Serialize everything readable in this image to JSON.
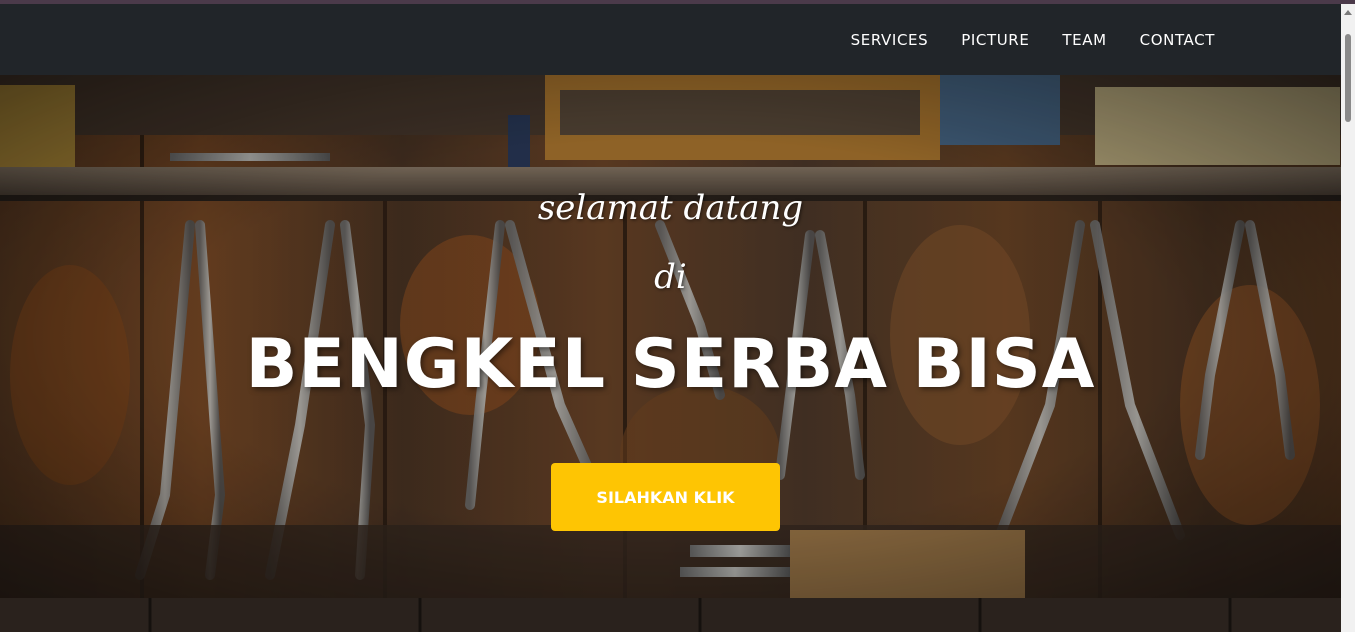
{
  "navbar": {
    "links": [
      "SERVICES",
      "PICTURE",
      "TEAM",
      "CONTACT"
    ]
  },
  "hero": {
    "welcome": "selamat datang",
    "di": "di",
    "headline": "BENGKEL SERBA BISA",
    "cta_label": "SILAHKAN KLIK"
  },
  "colors": {
    "navbar": "#212529",
    "accent": "#fec503",
    "text": "#ffffff"
  }
}
